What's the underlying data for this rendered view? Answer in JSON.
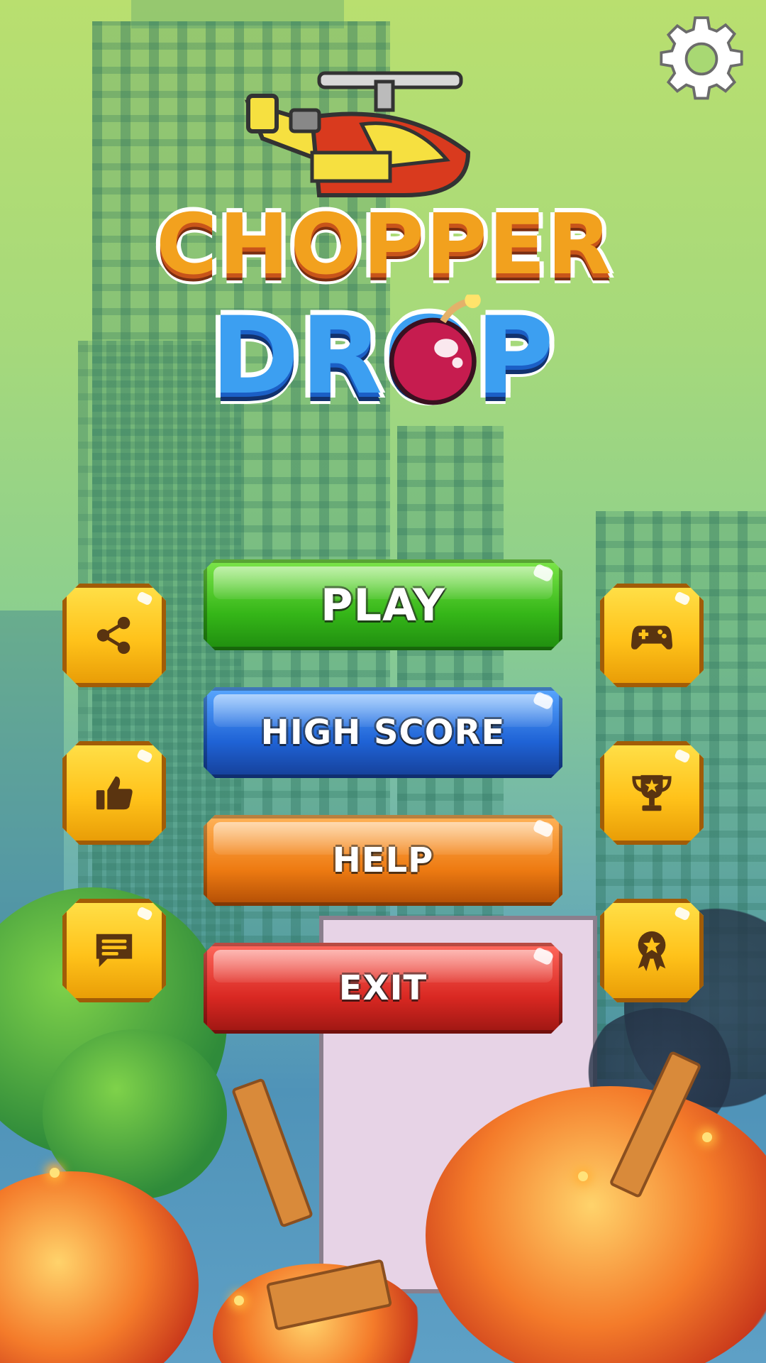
{
  "game": {
    "title_line1": "CHOPPER",
    "title_line2": "DROP"
  },
  "menu": {
    "play_label": "PLAY",
    "high_score_label": "HIGH SCORE",
    "help_label": "HELP",
    "exit_label": "EXIT"
  },
  "side_buttons": {
    "left": [
      "share-icon",
      "thumbs-up-icon",
      "chat-icon"
    ],
    "right": [
      "gamepad-icon",
      "trophy-icon",
      "medal-icon"
    ]
  },
  "colors": {
    "play": "#35b618",
    "high_score": "#1f63d6",
    "help": "#ee7b12",
    "exit": "#d92822",
    "side_button": "#ffc21a",
    "icon": "#5a3410"
  }
}
